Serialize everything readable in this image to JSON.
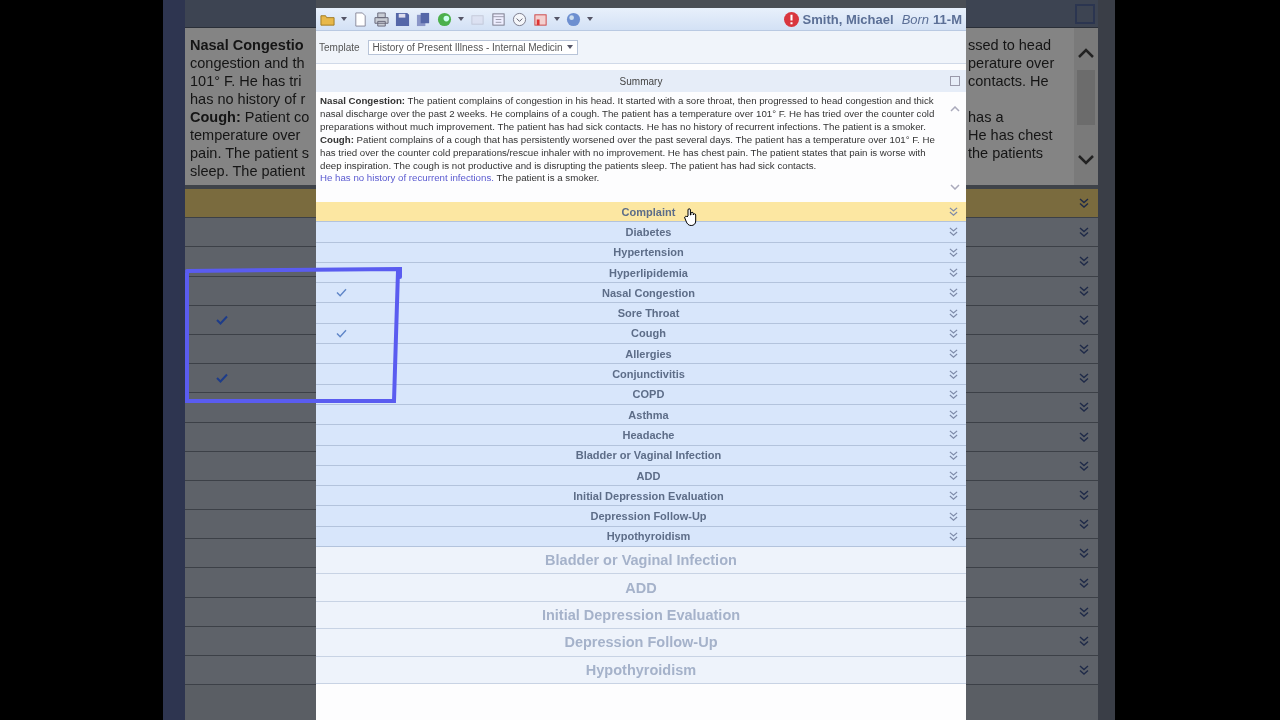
{
  "background": {
    "note_lines": [
      {
        "left": "**Nasal Congestio**",
        "right": "ssed to head"
      },
      {
        "left": "congestion and th",
        "right": "perature over"
      },
      {
        "left": "101° F. He has tri",
        "right": "contacts. He"
      },
      {
        "left": "has no history of r"
      },
      {
        "left": "**Cough:** Patient co",
        "right": "has a"
      },
      {
        "left": "temperature over",
        "right": "He has chest"
      },
      {
        "left": "pain. The patient s",
        "right": "the patients"
      },
      {
        "left": "sleep. The patient"
      }
    ]
  },
  "window": {
    "patient": {
      "name": "Smith, Michael",
      "born_label": "Born",
      "born_value": "11-M"
    },
    "template": {
      "label": "Template",
      "value": "History of Present Illness - Internal Medicin"
    },
    "summary": {
      "title": "Summary",
      "paragraphs": [
        [
          {
            "kind": "text",
            "text": "**Nasal Congestion:** The patient complains of congestion in his head. It started with a sore throat, then progressed to head congestion and thick nasal discharge over the past 2 weeks. He complains of a cough. The patient has a temperature over 101° F. He has tried over the counter cold preparations without much improvement. The patient has had sick contacts. He has no history of recurrent infections. The patient is a smoker."
          }
        ],
        [
          {
            "kind": "text",
            "text": "**Cough:** Patient complains of a cough that has persistently worsened over the past several days. The patient has a temperature over 101° F. He has tried over the counter cold preparations/rescue inhaler with no improvement. He has chest pain. The patient states that pain is worse with deep inspiration. The cough is not productive and is disrupting the patients sleep. The patient has had sick contacts. "
          },
          {
            "kind": "link",
            "text": "He has no history of recurrent infections."
          },
          {
            "kind": "text",
            "text": " The patient is a smoker."
          }
        ]
      ]
    },
    "conditions": [
      {
        "label": "Complaint",
        "selected": true,
        "checked": false
      },
      {
        "label": "Diabetes",
        "selected": false,
        "checked": false
      },
      {
        "label": "Hypertension",
        "selected": false,
        "checked": false
      },
      {
        "label": "Hyperlipidemia",
        "selected": false,
        "checked": false
      },
      {
        "label": "Nasal Congestion",
        "selected": false,
        "checked": true
      },
      {
        "label": "Sore Throat",
        "selected": false,
        "checked": false
      },
      {
        "label": "Cough",
        "selected": false,
        "checked": true
      },
      {
        "label": "Allergies",
        "selected": false,
        "checked": false
      },
      {
        "label": "Conjunctivitis",
        "selected": false,
        "checked": false
      },
      {
        "label": "COPD",
        "selected": false,
        "checked": false
      },
      {
        "label": "Asthma",
        "selected": false,
        "checked": false
      },
      {
        "label": "Headache",
        "selected": false,
        "checked": false
      },
      {
        "label": "Bladder or Vaginal Infection",
        "selected": false,
        "checked": false
      },
      {
        "label": "ADD",
        "selected": false,
        "checked": false
      },
      {
        "label": "Initial Depression Evaluation",
        "selected": false,
        "checked": false
      },
      {
        "label": "Depression Follow-Up",
        "selected": false,
        "checked": false
      },
      {
        "label": "Hypothyroidism",
        "selected": false,
        "checked": false
      }
    ],
    "zoomed_rows": [
      "Bladder or Vaginal Infection",
      "ADD",
      "Initial Depression Evaluation",
      "Depression Follow-Up",
      "Hypothyroidism"
    ]
  }
}
